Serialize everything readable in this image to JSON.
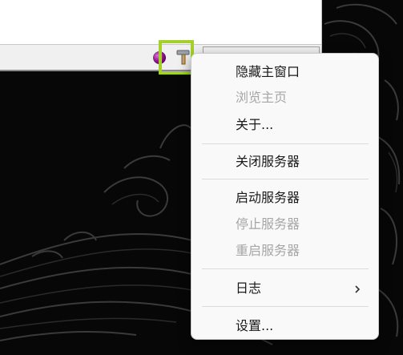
{
  "app_window": {
    "status_bar": {
      "tray_icons": [
        "purple-ball-icon",
        "hammer-icon"
      ]
    }
  },
  "context_menu": {
    "items": [
      {
        "label": "隐藏主窗口",
        "enabled": true
      },
      {
        "label": "浏览主页",
        "enabled": false
      },
      {
        "label": "关于...",
        "enabled": true
      },
      {
        "label": "关闭服务器",
        "enabled": true
      },
      {
        "label": "启动服务器",
        "enabled": true
      },
      {
        "label": "停止服务器",
        "enabled": false
      },
      {
        "label": "重启服务器",
        "enabled": false
      },
      {
        "label": "日志",
        "enabled": true,
        "submenu": true
      },
      {
        "label": "设置...",
        "enabled": true
      }
    ]
  },
  "colors": {
    "highlight_border": "#a3d12a",
    "disabled_text": "#a6a6a6",
    "menu_background": "#f9f9f9"
  }
}
